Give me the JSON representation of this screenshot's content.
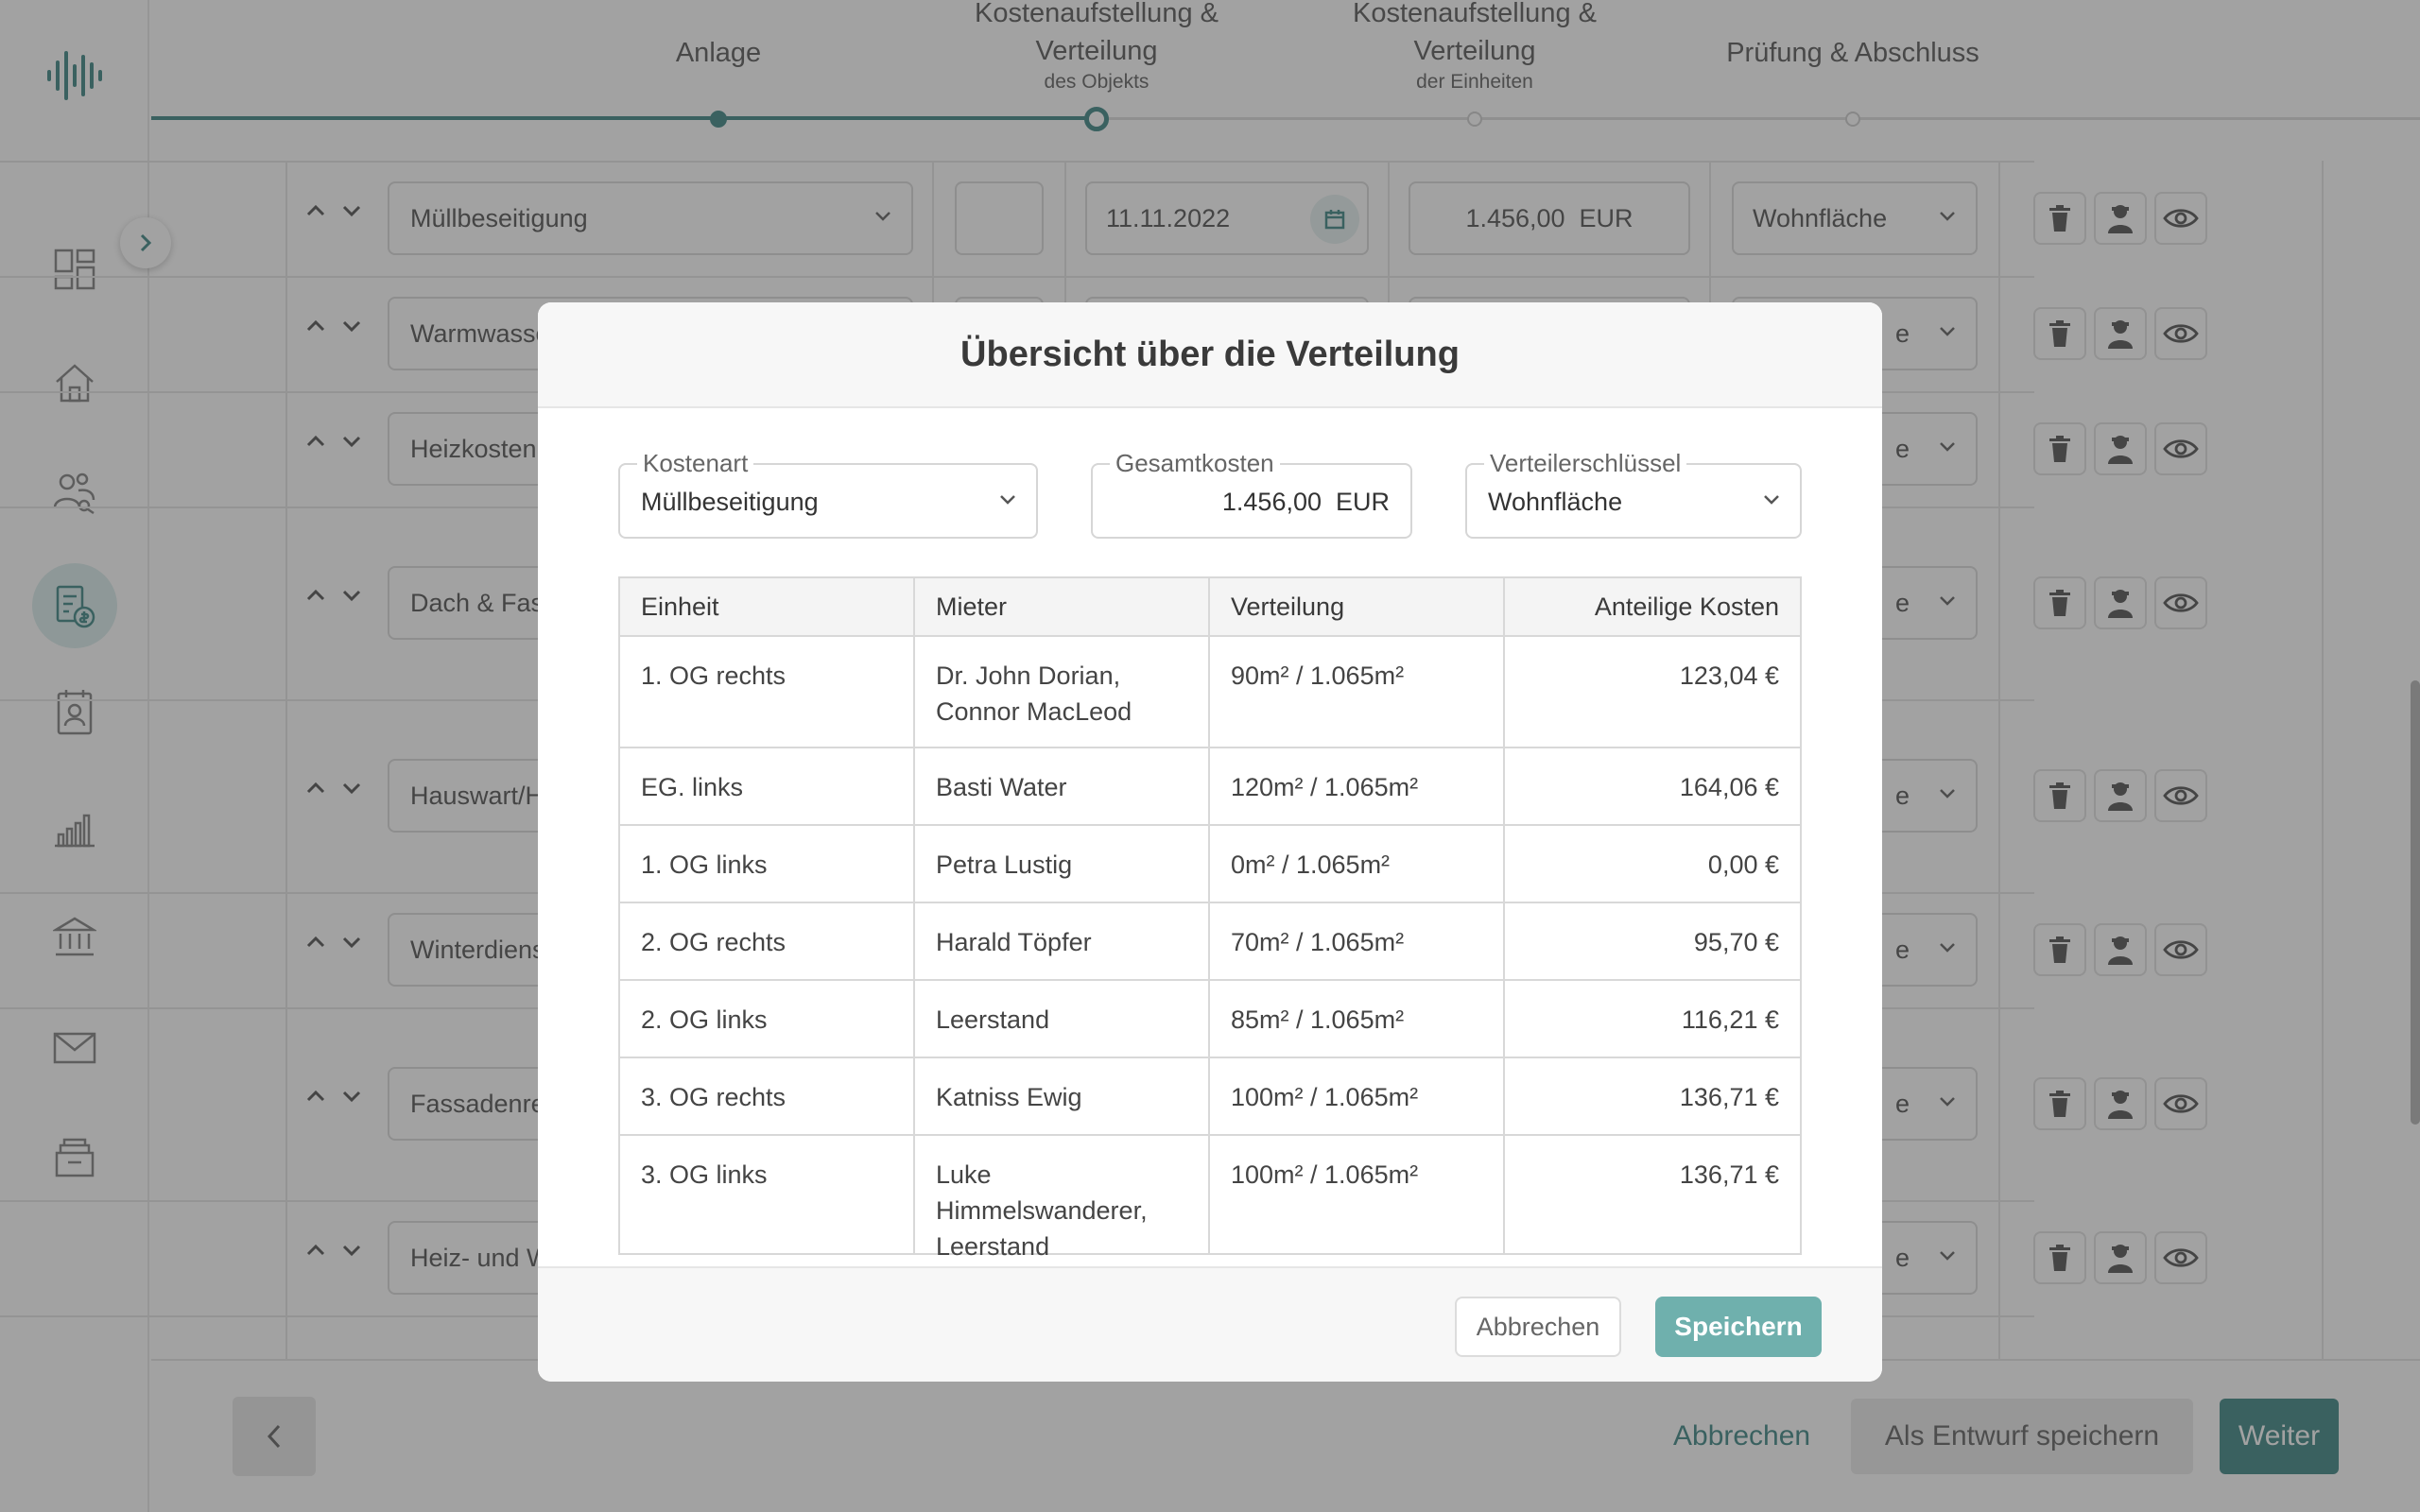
{
  "colors": {
    "primary": "#2f7d7b",
    "primary_light": "#6fb0ad",
    "overlay": "rgba(70,70,70,0.5)"
  },
  "sidebar": {
    "logo_icon": "logo-bars-icon",
    "items": [
      {
        "icon": "dashboard-icon"
      },
      {
        "icon": "home-icon"
      },
      {
        "icon": "tenants-icon"
      },
      {
        "icon": "accounting-icon",
        "active": true
      },
      {
        "icon": "contacts-icon"
      },
      {
        "icon": "chart-icon"
      },
      {
        "icon": "bank-icon"
      },
      {
        "icon": "mail-icon"
      },
      {
        "icon": "archive-icon"
      }
    ]
  },
  "stepper": {
    "steps": [
      {
        "title": "Anlage",
        "subtitle": ""
      },
      {
        "title": "Kostenaufstellung & Verteilung",
        "subtitle": "des Objekts"
      },
      {
        "title": "Kostenaufstellung & Verteilung",
        "subtitle": "der Einheiten"
      },
      {
        "title": "Prüfung & Abschluss",
        "subtitle": ""
      }
    ]
  },
  "background_rows": [
    {
      "cost_type": "Müllbeseitigung",
      "date": "11.11.2022",
      "amount": "1.456,00  EUR",
      "key": "Wohnfläche"
    },
    {
      "cost_type": "Warmwasse",
      "key": "e"
    },
    {
      "cost_type": "Heizkosten",
      "key": "e"
    },
    {
      "cost_type": "Dach & Fass",
      "key": "e"
    },
    {
      "cost_type": "Hauswart/H",
      "key": "e"
    },
    {
      "cost_type": "Winterdiens",
      "key": "e"
    },
    {
      "cost_type": "Fassadenre",
      "key": "e"
    },
    {
      "cost_type": "Heiz- und W",
      "key": "e"
    }
  ],
  "footer": {
    "cancel": "Abbrechen",
    "save_draft": "Als Entwurf speichern",
    "next": "Weiter"
  },
  "modal": {
    "title": "Übersicht über die Verteilung",
    "cost_type": {
      "label": "Kostenart",
      "value": "Müllbeseitigung"
    },
    "total": {
      "label": "Gesamtkosten",
      "value": "1.456,00  EUR"
    },
    "key": {
      "label": "Verteilerschlüssel",
      "value": "Wohnfläche"
    },
    "table": {
      "headers": [
        "Einheit",
        "Mieter",
        "Verteilung",
        "Anteilige Kosten"
      ],
      "rows": [
        {
          "unit": "1. OG rechts",
          "tenant": "Dr. John Dorian, Connor MacLeod",
          "distribution": "90m² / 1.065m²",
          "cost": "123,04 €"
        },
        {
          "unit": "EG. links",
          "tenant": "Basti Water",
          "distribution": "120m² / 1.065m²",
          "cost": "164,06 €"
        },
        {
          "unit": "1. OG links",
          "tenant": "Petra Lustig",
          "distribution": "0m² / 1.065m²",
          "cost": "0,00 €"
        },
        {
          "unit": "2. OG rechts",
          "tenant": "Harald Töpfer",
          "distribution": "70m² / 1.065m²",
          "cost": "95,70 €"
        },
        {
          "unit": "2. OG links",
          "tenant": "Leerstand",
          "distribution": "85m² / 1.065m²",
          "cost": "116,21 €"
        },
        {
          "unit": "3. OG rechts",
          "tenant": "Katniss Ewig",
          "distribution": "100m² / 1.065m²",
          "cost": "136,71 €"
        },
        {
          "unit": "3. OG links",
          "tenant": "Luke Himmelswanderer, Leerstand",
          "distribution": "100m² / 1.065m²",
          "cost": "136,71 €"
        }
      ]
    },
    "cancel": "Abbrechen",
    "save": "Speichern"
  }
}
